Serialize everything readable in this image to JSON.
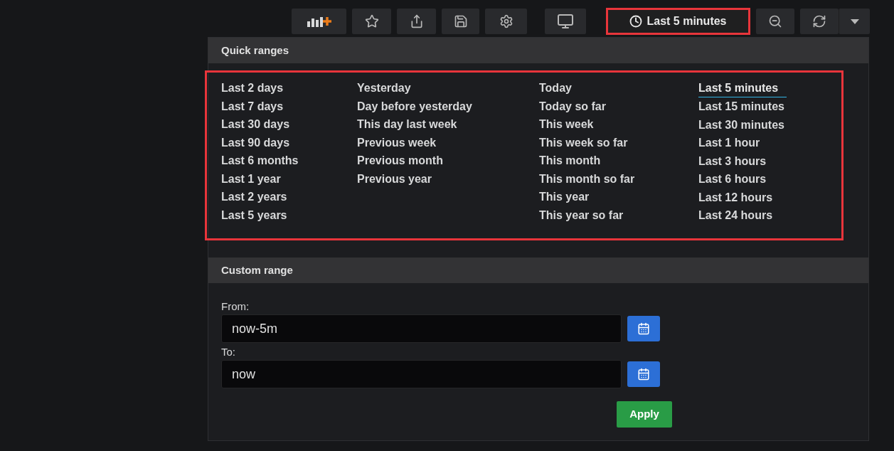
{
  "toolbar": {
    "buttons": [
      {
        "kind": "add-panel"
      },
      {
        "kind": "star"
      },
      {
        "kind": "share"
      },
      {
        "kind": "save"
      },
      {
        "kind": "settings"
      },
      {
        "kind": "tv"
      }
    ],
    "time_picker": {
      "label": "Last 5 minutes",
      "highlighted": true
    },
    "actions": [
      {
        "kind": "zoom-out"
      },
      {
        "kind": "refresh"
      },
      {
        "kind": "caret"
      }
    ]
  },
  "quick_ranges": {
    "title": "Quick ranges",
    "highlighted": true,
    "columns": [
      [
        {
          "label": "Last 2 days",
          "selected": false
        },
        {
          "label": "Last 7 days",
          "selected": false
        },
        {
          "label": "Last 30 days",
          "selected": false
        },
        {
          "label": "Last 90 days",
          "selected": false
        },
        {
          "label": "Last 6 months",
          "selected": false
        },
        {
          "label": "Last 1 year",
          "selected": false
        },
        {
          "label": "Last 2 years",
          "selected": false
        },
        {
          "label": "Last 5 years",
          "selected": false
        }
      ],
      [
        {
          "label": "Yesterday",
          "selected": false
        },
        {
          "label": "Day before yesterday",
          "selected": false
        },
        {
          "label": "This day last week",
          "selected": false
        },
        {
          "label": "Previous week",
          "selected": false
        },
        {
          "label": "Previous month",
          "selected": false
        },
        {
          "label": "Previous year",
          "selected": false
        }
      ],
      [
        {
          "label": "Today",
          "selected": false
        },
        {
          "label": "Today so far",
          "selected": false
        },
        {
          "label": "This week",
          "selected": false
        },
        {
          "label": "This week so far",
          "selected": false
        },
        {
          "label": "This month",
          "selected": false
        },
        {
          "label": "This month so far",
          "selected": false
        },
        {
          "label": "This year",
          "selected": false
        },
        {
          "label": "This year so far",
          "selected": false
        }
      ],
      [
        {
          "label": "Last 5 minutes",
          "selected": true
        },
        {
          "label": "Last 15 minutes",
          "selected": false
        },
        {
          "label": "Last 30 minutes",
          "selected": false
        },
        {
          "label": "Last 1 hour",
          "selected": false
        },
        {
          "label": "Last 3 hours",
          "selected": false
        },
        {
          "label": "Last 6 hours",
          "selected": false
        },
        {
          "label": "Last 12 hours",
          "selected": false
        },
        {
          "label": "Last 24 hours",
          "selected": false
        }
      ]
    ]
  },
  "custom_range": {
    "title": "Custom range",
    "fields": [
      {
        "label": "From:",
        "value": "now-5m"
      },
      {
        "label": "To:",
        "value": "now"
      }
    ],
    "apply": "Apply"
  }
}
